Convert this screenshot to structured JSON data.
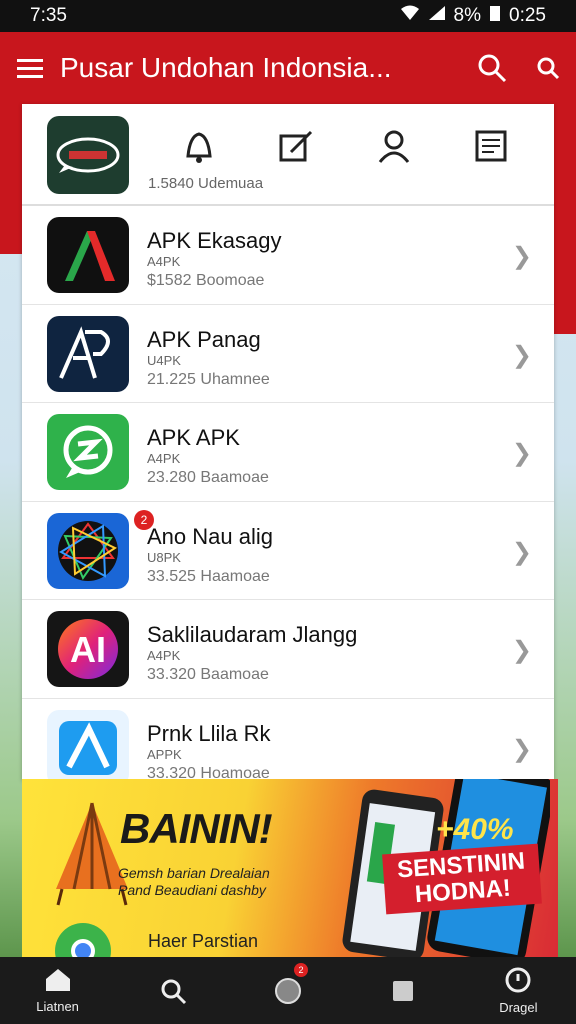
{
  "status": {
    "time": "7:35",
    "battery": "8%",
    "clock": "0:25"
  },
  "appbar": {
    "title": "Pusar Undohan Indonsia..."
  },
  "featured": {
    "meta": "1.5840 Udemuaa"
  },
  "apps": [
    {
      "name": "APK Ekasagy",
      "type": "A4PK",
      "downloads": "$1582 Boomoae",
      "icon": "apk-red-green-icon"
    },
    {
      "name": "APK Panag",
      "type": "U4PK",
      "downloads": "21.225 Uhamnee",
      "icon": "apk-outline-icon"
    },
    {
      "name": "APK APK",
      "type": "A4PK",
      "downloads": "23.280 Baamoae",
      "icon": "chat-green-icon"
    },
    {
      "name": "Ano Nau alig",
      "type": "U8PK",
      "downloads": "33.525 Haamoae",
      "icon": "geometry-icon"
    },
    {
      "name": "Saklilaudaram Jlangg",
      "type": "A4PK",
      "downloads": "33.320 Baamoae",
      "icon": "ai-gradient-icon"
    },
    {
      "name": "Prnk Llila Rk",
      "type": "APPK",
      "downloads": "33.320 Hoamoae",
      "icon": "a-blue-icon"
    }
  ],
  "badge": "2",
  "banner": {
    "headline": "BAININ!",
    "sub1": "Gemsh barian Drealaian",
    "sub2": "Pand Beaudiani dashby",
    "pct": "+40%",
    "tag1": "SENSTININ",
    "tag2": "HODNA!",
    "promo": "Haer Parstian"
  },
  "nav": [
    {
      "label": "Liatnen"
    },
    {
      "label": ""
    },
    {
      "label": ""
    },
    {
      "label": ""
    },
    {
      "label": "Dragel"
    }
  ],
  "nav_badge": "2",
  "colors": {
    "primary": "#c8161d",
    "nav": "#1b1b1b"
  }
}
